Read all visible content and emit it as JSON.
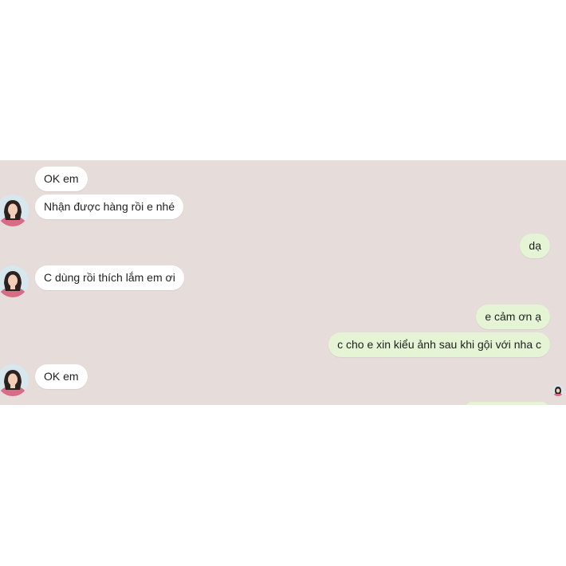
{
  "conversation": {
    "messages": [
      {
        "direction": "incoming",
        "text": "OK em"
      },
      {
        "direction": "incoming",
        "text": "Nhận được hàng rồi e nhé"
      },
      {
        "direction": "outgoing",
        "text": "dạ"
      },
      {
        "direction": "incoming",
        "text": "C dùng rồi thích lắm em ơi"
      },
      {
        "direction": "outgoing",
        "text": "e cảm ơn ạ"
      },
      {
        "direction": "outgoing",
        "text": "c cho e xin kiểu ảnh sau khi gội với nha c"
      },
      {
        "direction": "incoming",
        "text": "OK em"
      }
    ]
  },
  "colors": {
    "chat_background": "#e6dcd9",
    "incoming_bubble": "#ffffff",
    "outgoing_bubble": "#e4f4d4"
  },
  "icons": {
    "contact_avatar": "avatar-photo",
    "seen_indicator": "seen-avatar-icon"
  }
}
